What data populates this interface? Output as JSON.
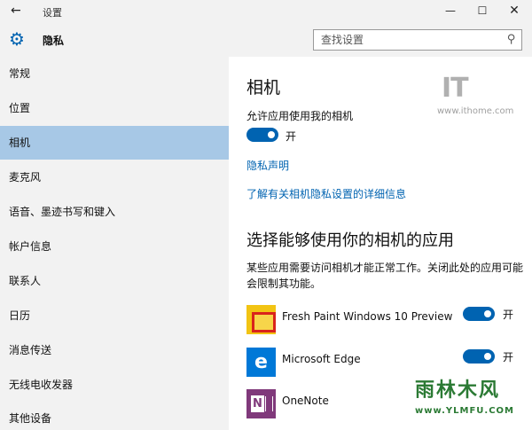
{
  "titlebar": {
    "back_icon": "back-arrow-icon",
    "title": "设置",
    "minimize_icon": "minimize-icon",
    "maximize_icon": "maximize-icon",
    "close_icon": "close-icon"
  },
  "header": {
    "icon": "gear-icon",
    "title": "隐私",
    "search": {
      "placeholder": "查找设置",
      "value": "",
      "icon": "search-icon"
    }
  },
  "sidebar": {
    "items": [
      {
        "label": "常规",
        "active": false
      },
      {
        "label": "位置",
        "active": false
      },
      {
        "label": "相机",
        "active": true
      },
      {
        "label": "麦克风",
        "active": false
      },
      {
        "label": "语音、墨迹书写和键入",
        "active": false
      },
      {
        "label": "帐户信息",
        "active": false
      },
      {
        "label": "联系人",
        "active": false
      },
      {
        "label": "日历",
        "active": false
      },
      {
        "label": "消息传送",
        "active": false
      },
      {
        "label": "无线电收发器",
        "active": false
      },
      {
        "label": "其他设备",
        "active": false
      }
    ]
  },
  "main": {
    "title": "相机",
    "allow_label": "允许应用使用我的相机",
    "allow_toggle": {
      "state": "on",
      "label": "开"
    },
    "privacy_link": "隐私声明",
    "learn_more_link": "了解有关相机隐私设置的详细信息",
    "section_title": "选择能够使用你的相机的应用",
    "section_desc": "某些应用需要访问相机才能正常工作。关闭此处的应用可能会限制其功能。",
    "apps": [
      {
        "name": "Fresh Paint Windows 10 Preview",
        "icon": "fresh-paint-icon",
        "toggle_label": "开",
        "state": "on"
      },
      {
        "name": "Microsoft Edge",
        "icon": "edge-icon",
        "toggle_label": "开",
        "state": "on"
      },
      {
        "name": "OneNote",
        "icon": "onenote-icon"
      }
    ]
  },
  "watermarks": {
    "ithome_logo": "IT",
    "ithome_url": "www.ithome.com",
    "ylmfu_text": "雨林木风",
    "ylmfu_url": "www.YLMFU.COM"
  },
  "colors": {
    "accent": "#0063b1",
    "sidebar_bg": "#f2f2f2",
    "active_item_bg": "#a7c8e6",
    "link": "#0063b1"
  }
}
